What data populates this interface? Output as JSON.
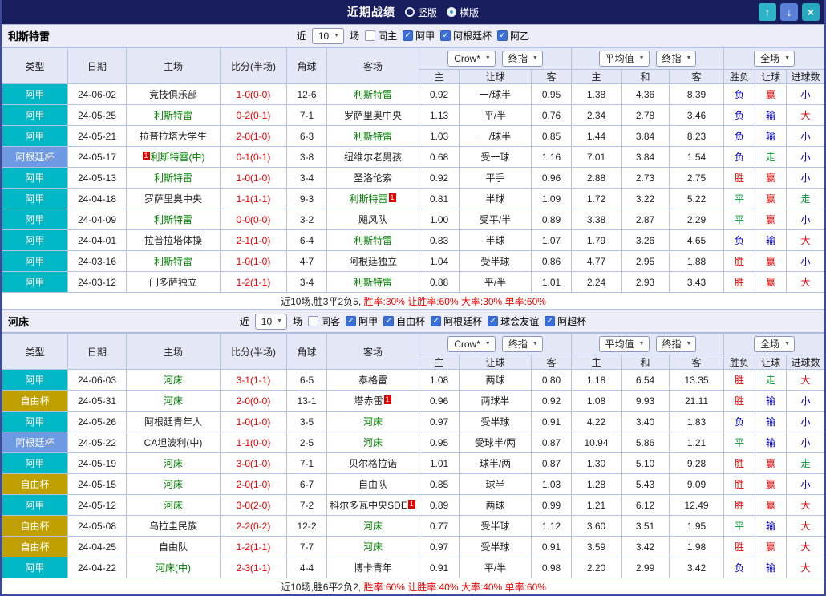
{
  "titlebar": {
    "title": "近期战绩",
    "radios": [
      {
        "label": "竖版",
        "selected": false
      },
      {
        "label": "横版",
        "selected": true
      }
    ],
    "buttons": {
      "up": "↑",
      "down": "↓",
      "close": "×"
    }
  },
  "colors": {
    "types": {
      "阿甲": "#00b7c6",
      "阿根廷杯": "#6d9ae3",
      "自由杯": "#bfa000",
      "阿乙": "#00b7c6"
    },
    "focus_team": "#008000",
    "score": "#ee0000"
  },
  "filter_labels": {
    "near": "近",
    "games": "场"
  },
  "table_header": {
    "columns": [
      "类型",
      "日期",
      "主场",
      "比分(半场)",
      "角球",
      "客场"
    ],
    "group1_selects": [
      "Crow*",
      "终指"
    ],
    "group2_selects": [
      "平均值",
      "终指"
    ],
    "group3_selects": [
      "全场"
    ],
    "subheaders": [
      "主",
      "让球",
      "客",
      "主",
      "和",
      "客",
      "胜负",
      "让球",
      "进球数"
    ]
  },
  "sections": [
    {
      "team": "利斯特雷",
      "near_count": "10",
      "same": {
        "label": "同主",
        "checked": false
      },
      "leagues": [
        {
          "label": "阿甲",
          "checked": true
        },
        {
          "label": "阿根廷杯",
          "checked": true
        },
        {
          "label": "阿乙",
          "checked": true
        }
      ],
      "rows": [
        {
          "type": "阿甲",
          "date": "24-06-02",
          "home": {
            "name": "竞技俱乐部",
            "focus": false
          },
          "score": "1-0(0-0)",
          "corner": "12-6",
          "away": {
            "name": "利斯特雷",
            "focus": true
          },
          "odds": [
            "0.92",
            "一/球半",
            "0.95"
          ],
          "avg": [
            "1.38",
            "4.36",
            "8.39"
          ],
          "res": [
            {
              "t": "负",
              "c": "blue"
            },
            {
              "t": "赢",
              "c": "red"
            },
            {
              "t": "小",
              "c": "blue"
            }
          ]
        },
        {
          "type": "阿甲",
          "date": "24-05-25",
          "home": {
            "name": "利斯特雷",
            "focus": true
          },
          "score": "0-2(0-1)",
          "corner": "7-1",
          "away": {
            "name": "罗萨里奥中央",
            "focus": false
          },
          "odds": [
            "1.13",
            "平/半",
            "0.76"
          ],
          "avg": [
            "2.34",
            "2.78",
            "3.46"
          ],
          "res": [
            {
              "t": "负",
              "c": "blue"
            },
            {
              "t": "输",
              "c": "blue"
            },
            {
              "t": "大",
              "c": "red"
            }
          ]
        },
        {
          "type": "阿甲",
          "date": "24-05-21",
          "home": {
            "name": "拉普拉塔大学生",
            "focus": false
          },
          "score": "2-0(1-0)",
          "corner": "6-3",
          "away": {
            "name": "利斯特雷",
            "focus": true
          },
          "odds": [
            "1.03",
            "一/球半",
            "0.85"
          ],
          "avg": [
            "1.44",
            "3.84",
            "8.23"
          ],
          "res": [
            {
              "t": "负",
              "c": "blue"
            },
            {
              "t": "输",
              "c": "blue"
            },
            {
              "t": "小",
              "c": "blue"
            }
          ]
        },
        {
          "type": "阿根廷杯",
          "date": "24-05-17",
          "home": {
            "name": "利斯特雷(中)",
            "focus": true,
            "badge": "1",
            "badge_pos": "before"
          },
          "score": "0-1(0-1)",
          "corner": "3-8",
          "away": {
            "name": "纽维尔老男孩",
            "focus": false
          },
          "odds": [
            "0.68",
            "受一球",
            "1.16"
          ],
          "avg": [
            "7.01",
            "3.84",
            "1.54"
          ],
          "res": [
            {
              "t": "负",
              "c": "blue"
            },
            {
              "t": "走",
              "c": "green"
            },
            {
              "t": "小",
              "c": "blue"
            }
          ]
        },
        {
          "type": "阿甲",
          "date": "24-05-13",
          "home": {
            "name": "利斯特雷",
            "focus": true
          },
          "score": "1-0(1-0)",
          "corner": "3-4",
          "away": {
            "name": "圣洛伦索",
            "focus": false
          },
          "odds": [
            "0.92",
            "平手",
            "0.96"
          ],
          "avg": [
            "2.88",
            "2.73",
            "2.75"
          ],
          "res": [
            {
              "t": "胜",
              "c": "red"
            },
            {
              "t": "赢",
              "c": "red"
            },
            {
              "t": "小",
              "c": "blue"
            }
          ]
        },
        {
          "type": "阿甲",
          "date": "24-04-18",
          "home": {
            "name": "罗萨里奥中央",
            "focus": false
          },
          "score": "1-1(1-1)",
          "corner": "9-3",
          "away": {
            "name": "利斯特雷",
            "focus": true,
            "badge": "1",
            "badge_pos": "after"
          },
          "odds": [
            "0.81",
            "半球",
            "1.09"
          ],
          "avg": [
            "1.72",
            "3.22",
            "5.22"
          ],
          "res": [
            {
              "t": "平",
              "c": "green"
            },
            {
              "t": "赢",
              "c": "red"
            },
            {
              "t": "走",
              "c": "green"
            }
          ]
        },
        {
          "type": "阿甲",
          "date": "24-04-09",
          "home": {
            "name": "利斯特雷",
            "focus": true
          },
          "score": "0-0(0-0)",
          "corner": "3-2",
          "away": {
            "name": "飓风队",
            "focus": false
          },
          "odds": [
            "1.00",
            "受平/半",
            "0.89"
          ],
          "avg": [
            "3.38",
            "2.87",
            "2.29"
          ],
          "res": [
            {
              "t": "平",
              "c": "green"
            },
            {
              "t": "赢",
              "c": "red"
            },
            {
              "t": "小",
              "c": "blue"
            }
          ]
        },
        {
          "type": "阿甲",
          "date": "24-04-01",
          "home": {
            "name": "拉普拉塔体操",
            "focus": false
          },
          "score": "2-1(1-0)",
          "corner": "6-4",
          "away": {
            "name": "利斯特雷",
            "focus": true
          },
          "odds": [
            "0.83",
            "半球",
            "1.07"
          ],
          "avg": [
            "1.79",
            "3.26",
            "4.65"
          ],
          "res": [
            {
              "t": "负",
              "c": "blue"
            },
            {
              "t": "输",
              "c": "blue"
            },
            {
              "t": "大",
              "c": "red"
            }
          ]
        },
        {
          "type": "阿甲",
          "date": "24-03-16",
          "home": {
            "name": "利斯特雷",
            "focus": true
          },
          "score": "1-0(1-0)",
          "corner": "4-7",
          "away": {
            "name": "阿根廷独立",
            "focus": false
          },
          "odds": [
            "1.04",
            "受半球",
            "0.86"
          ],
          "avg": [
            "4.77",
            "2.95",
            "1.88"
          ],
          "res": [
            {
              "t": "胜",
              "c": "red"
            },
            {
              "t": "赢",
              "c": "red"
            },
            {
              "t": "小",
              "c": "blue"
            }
          ]
        },
        {
          "type": "阿甲",
          "date": "24-03-12",
          "home": {
            "name": "门多萨独立",
            "focus": false
          },
          "score": "1-2(1-1)",
          "corner": "3-4",
          "away": {
            "name": "利斯特雷",
            "focus": true
          },
          "odds": [
            "0.88",
            "平/半",
            "1.01"
          ],
          "avg": [
            "2.24",
            "2.93",
            "3.43"
          ],
          "res": [
            {
              "t": "胜",
              "c": "red"
            },
            {
              "t": "赢",
              "c": "red"
            },
            {
              "t": "大",
              "c": "red"
            }
          ]
        }
      ],
      "footer": [
        {
          "text": "近10场,胜3平2负5,",
          "color": "#222222"
        },
        {
          "text": " 胜率:30% 让胜率:60% 大率:30% 单率:60%",
          "color": "#ee0000"
        }
      ]
    },
    {
      "team": "河床",
      "near_count": "10",
      "same": {
        "label": "同客",
        "checked": false
      },
      "leagues": [
        {
          "label": "阿甲",
          "checked": true
        },
        {
          "label": "自由杯",
          "checked": true
        },
        {
          "label": "阿根廷杯",
          "checked": true
        },
        {
          "label": "球会友谊",
          "checked": true
        },
        {
          "label": "阿超杯",
          "checked": true
        }
      ],
      "rows": [
        {
          "type": "阿甲",
          "date": "24-06-03",
          "home": {
            "name": "河床",
            "focus": true
          },
          "score": "3-1(1-1)",
          "corner": "6-5",
          "away": {
            "name": "泰格雷",
            "focus": false
          },
          "odds": [
            "1.08",
            "两球",
            "0.80"
          ],
          "avg": [
            "1.18",
            "6.54",
            "13.35"
          ],
          "res": [
            {
              "t": "胜",
              "c": "red"
            },
            {
              "t": "走",
              "c": "green"
            },
            {
              "t": "大",
              "c": "red"
            }
          ]
        },
        {
          "type": "自由杯",
          "date": "24-05-31",
          "home": {
            "name": "河床",
            "focus": true
          },
          "score": "2-0(0-0)",
          "corner": "13-1",
          "away": {
            "name": "塔赤雷",
            "focus": false,
            "badge": "1",
            "badge_pos": "after"
          },
          "odds": [
            "0.96",
            "两球半",
            "0.92"
          ],
          "avg": [
            "1.08",
            "9.93",
            "21.11"
          ],
          "res": [
            {
              "t": "胜",
              "c": "red"
            },
            {
              "t": "输",
              "c": "blue"
            },
            {
              "t": "小",
              "c": "blue"
            }
          ]
        },
        {
          "type": "阿甲",
          "date": "24-05-26",
          "home": {
            "name": "阿根廷青年人",
            "focus": false
          },
          "score": "1-0(1-0)",
          "corner": "3-5",
          "away": {
            "name": "河床",
            "focus": true
          },
          "odds": [
            "0.97",
            "受半球",
            "0.91"
          ],
          "avg": [
            "4.22",
            "3.40",
            "1.83"
          ],
          "res": [
            {
              "t": "负",
              "c": "blue"
            },
            {
              "t": "输",
              "c": "blue"
            },
            {
              "t": "小",
              "c": "blue"
            }
          ]
        },
        {
          "type": "阿根廷杯",
          "date": "24-05-22",
          "home": {
            "name": "CA坦波利(中)",
            "focus": false
          },
          "score": "1-1(0-0)",
          "corner": "2-5",
          "away": {
            "name": "河床",
            "focus": true
          },
          "odds": [
            "0.95",
            "受球半/两",
            "0.87"
          ],
          "avg": [
            "10.94",
            "5.86",
            "1.21"
          ],
          "res": [
            {
              "t": "平",
              "c": "green"
            },
            {
              "t": "输",
              "c": "blue"
            },
            {
              "t": "小",
              "c": "blue"
            }
          ]
        },
        {
          "type": "阿甲",
          "date": "24-05-19",
          "home": {
            "name": "河床",
            "focus": true
          },
          "score": "3-0(1-0)",
          "corner": "7-1",
          "away": {
            "name": "贝尔格拉诺",
            "focus": false
          },
          "odds": [
            "1.01",
            "球半/两",
            "0.87"
          ],
          "avg": [
            "1.30",
            "5.10",
            "9.28"
          ],
          "res": [
            {
              "t": "胜",
              "c": "red"
            },
            {
              "t": "赢",
              "c": "red"
            },
            {
              "t": "走",
              "c": "green"
            }
          ]
        },
        {
          "type": "自由杯",
          "date": "24-05-15",
          "home": {
            "name": "河床",
            "focus": true
          },
          "score": "2-0(1-0)",
          "corner": "6-7",
          "away": {
            "name": "自由队",
            "focus": false
          },
          "odds": [
            "0.85",
            "球半",
            "1.03"
          ],
          "avg": [
            "1.28",
            "5.43",
            "9.09"
          ],
          "res": [
            {
              "t": "胜",
              "c": "red"
            },
            {
              "t": "赢",
              "c": "red"
            },
            {
              "t": "小",
              "c": "blue"
            }
          ]
        },
        {
          "type": "阿甲",
          "date": "24-05-12",
          "home": {
            "name": "河床",
            "focus": true
          },
          "score": "3-0(2-0)",
          "corner": "7-2",
          "away": {
            "name": "科尔多瓦中央SDE",
            "focus": false,
            "badge": "1",
            "badge_pos": "after"
          },
          "odds": [
            "0.89",
            "两球",
            "0.99"
          ],
          "avg": [
            "1.21",
            "6.12",
            "12.49"
          ],
          "res": [
            {
              "t": "胜",
              "c": "red"
            },
            {
              "t": "赢",
              "c": "red"
            },
            {
              "t": "大",
              "c": "red"
            }
          ]
        },
        {
          "type": "自由杯",
          "date": "24-05-08",
          "home": {
            "name": "乌拉圭民族",
            "focus": false
          },
          "score": "2-2(0-2)",
          "corner": "12-2",
          "away": {
            "name": "河床",
            "focus": true
          },
          "odds": [
            "0.77",
            "受半球",
            "1.12"
          ],
          "avg": [
            "3.60",
            "3.51",
            "1.95"
          ],
          "res": [
            {
              "t": "平",
              "c": "green"
            },
            {
              "t": "输",
              "c": "blue"
            },
            {
              "t": "大",
              "c": "red"
            }
          ]
        },
        {
          "type": "自由杯",
          "date": "24-04-25",
          "home": {
            "name": "自由队",
            "focus": false
          },
          "score": "1-2(1-1)",
          "corner": "7-7",
          "away": {
            "name": "河床",
            "focus": true
          },
          "odds": [
            "0.97",
            "受半球",
            "0.91"
          ],
          "avg": [
            "3.59",
            "3.42",
            "1.98"
          ],
          "res": [
            {
              "t": "胜",
              "c": "red"
            },
            {
              "t": "赢",
              "c": "red"
            },
            {
              "t": "大",
              "c": "red"
            }
          ]
        },
        {
          "type": "阿甲",
          "date": "24-04-22",
          "home": {
            "name": "河床(中)",
            "focus": true
          },
          "score": "2-3(1-1)",
          "corner": "4-4",
          "away": {
            "name": "博卡青年",
            "focus": false
          },
          "odds": [
            "0.91",
            "平/半",
            "0.98"
          ],
          "avg": [
            "2.20",
            "2.99",
            "3.42"
          ],
          "res": [
            {
              "t": "负",
              "c": "blue"
            },
            {
              "t": "输",
              "c": "blue"
            },
            {
              "t": "大",
              "c": "red"
            }
          ]
        }
      ],
      "footer": [
        {
          "text": "近10场,胜6平2负2,",
          "color": "#222222"
        },
        {
          "text": " 胜率:60% 让胜率:40% 大率:40% 单率:60%",
          "color": "#ee0000"
        }
      ]
    }
  ]
}
